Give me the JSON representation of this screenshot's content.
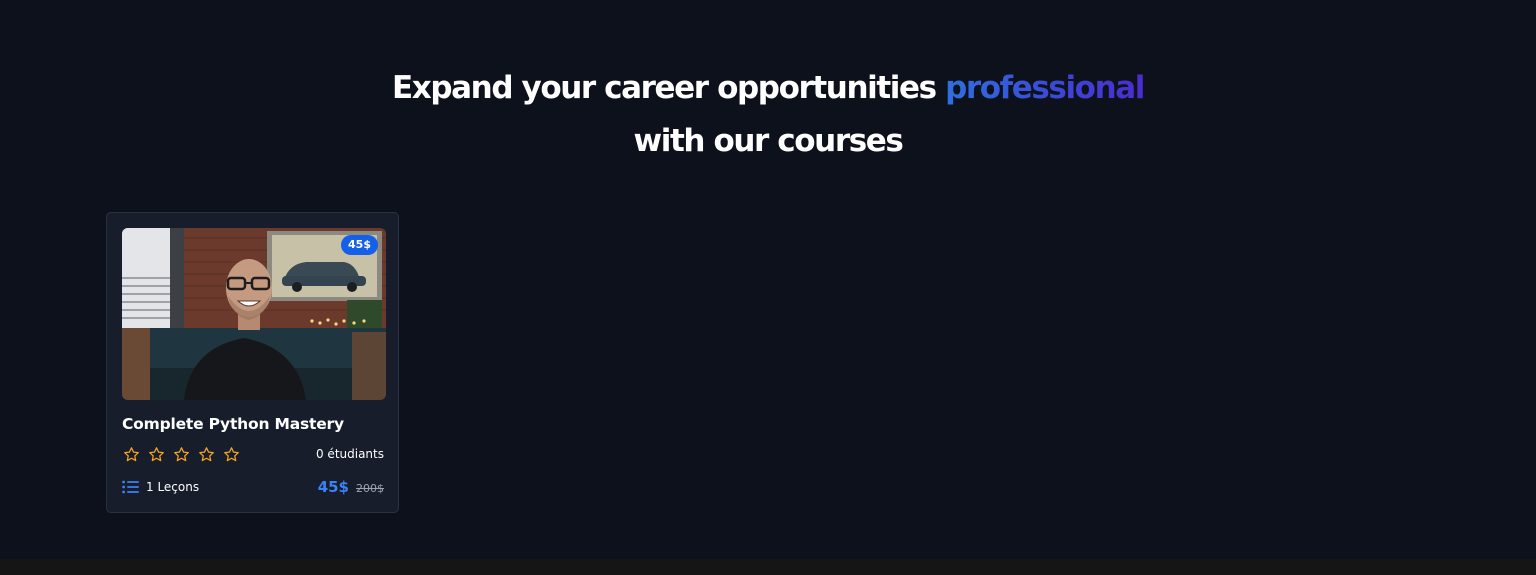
{
  "section": {
    "heading_line1": "Expand your career opportunities",
    "heading_accent": "professional",
    "heading_line2": "with our courses"
  },
  "course_card": {
    "badge_price": "45$",
    "title": "Complete Python Mastery",
    "rating": 0,
    "rating_max": 5,
    "students": "0 étudiants",
    "lessons": "1 Leçons",
    "price": "45$",
    "old_price": "200$",
    "icons": {
      "star": "star-outline-icon",
      "lessons": "list-icon"
    },
    "colors": {
      "star": "#f5a524",
      "price": "#3b82f6",
      "badge": "#1560e8"
    }
  }
}
